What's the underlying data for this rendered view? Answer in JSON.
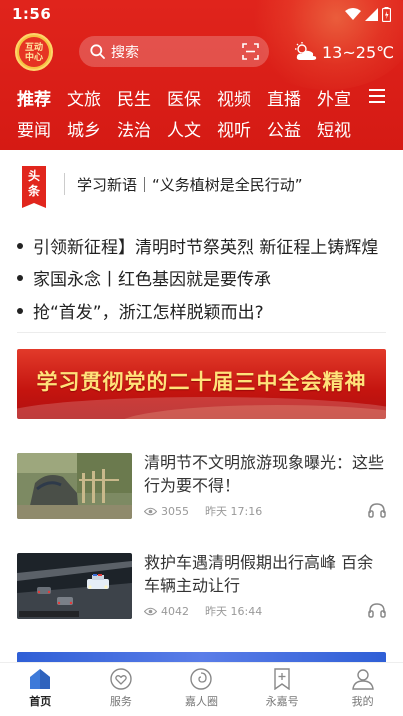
{
  "status_bar": {
    "time": "1:56"
  },
  "header": {
    "logo_line1": "互动",
    "logo_line2": "中心",
    "search_placeholder": "搜索",
    "weather": "13~25℃"
  },
  "tabs_row1": [
    "推荐",
    "文旅",
    "民生",
    "医保",
    "视频",
    "直播",
    "外宣"
  ],
  "tabs_row2": [
    "要闻",
    "城乡",
    "法治",
    "人文",
    "视听",
    "公益",
    "短视"
  ],
  "headline": {
    "badge_line1": "头",
    "badge_line2": "条",
    "text": "学习新语｜“义务植树是全民行动”"
  },
  "bullets": [
    "引领新征程】清明时节祭英烈 新征程上铸辉煌",
    "家国永念丨红色基因就是要传承",
    "抢“首发”，浙江怎样脱颖而出?"
  ],
  "banner": {
    "text": "学习贯彻党的二十届三中全会精神"
  },
  "news": [
    {
      "title": "清明节不文明旅游现象曝光：这些行为要不得！",
      "views": "3055",
      "time": "昨天 17:16"
    },
    {
      "title": "救护车遇清明假期出行高峰 百余车辆主动让行",
      "views": "4042",
      "time": "昨天 16:44"
    }
  ],
  "bottom_nav": [
    {
      "label": "首页",
      "icon": "home-icon",
      "active": true
    },
    {
      "label": "服务",
      "icon": "service-heart-icon",
      "active": false
    },
    {
      "label": "嘉人圈",
      "icon": "circle-icon",
      "active": false
    },
    {
      "label": "永嘉号",
      "icon": "bookmark-plus-icon",
      "active": false
    },
    {
      "label": "我的",
      "icon": "user-icon",
      "active": false
    }
  ],
  "colors": {
    "brand_red": "#e0241c",
    "active_nav": "#3e7ad9"
  }
}
